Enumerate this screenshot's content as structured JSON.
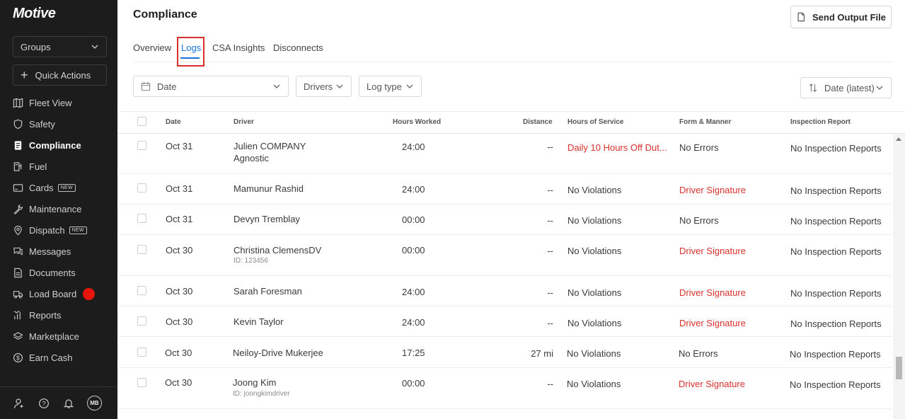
{
  "sidebar": {
    "logo": "Motive",
    "groups_label": "Groups",
    "quick_actions_label": "Quick Actions",
    "new_badge": "NEW",
    "items": [
      {
        "label": "Fleet View",
        "icon": "map-icon"
      },
      {
        "label": "Safety",
        "icon": "shield-icon"
      },
      {
        "label": "Compliance",
        "icon": "document-icon"
      },
      {
        "label": "Fuel",
        "icon": "fuel-pump-icon"
      },
      {
        "label": "Cards",
        "icon": "card-icon"
      },
      {
        "label": "Maintenance",
        "icon": "wrench-icon"
      },
      {
        "label": "Dispatch",
        "icon": "location-pin-icon"
      },
      {
        "label": "Messages",
        "icon": "chat-icon"
      },
      {
        "label": "Documents",
        "icon": "file-icon"
      },
      {
        "label": "Load Board",
        "icon": "truck-icon"
      },
      {
        "label": "Reports",
        "icon": "bar-chart-icon"
      },
      {
        "label": "Marketplace",
        "icon": "layers-icon"
      },
      {
        "label": "Earn Cash",
        "icon": "dollar-coin-icon"
      }
    ],
    "avatar_initials": "MB"
  },
  "header": {
    "title": "Compliance",
    "send_output_label": "Send Output File"
  },
  "tabs": [
    "Overview",
    "Logs",
    "CSA Insights",
    "Disconnects"
  ],
  "filters": {
    "date": "Date",
    "drivers": "Drivers",
    "log_type": "Log type",
    "sort": "Date (latest)"
  },
  "table": {
    "columns": [
      "Date",
      "Driver",
      "Hours Worked",
      "Distance",
      "Hours of Service",
      "Form & Manner",
      "Inspection Report"
    ],
    "rows": [
      {
        "date": "Oct 31",
        "driver": "Julien COMPANY",
        "driver2": "Agnostic",
        "hours": "24:00",
        "distance": "--",
        "hos": "Daily 10 Hours Off Dut...",
        "form": "No Errors",
        "inspection": "No Inspection Reports"
      },
      {
        "date": "Oct 31",
        "driver": "Mamunur Rashid",
        "hours": "24:00",
        "distance": "--",
        "hos": "No Violations",
        "form": "Driver Signature",
        "inspection": "No Inspection Reports"
      },
      {
        "date": "Oct 31",
        "driver": "Devyn Tremblay",
        "hours": "00:00",
        "distance": "--",
        "hos": "No Violations",
        "form": "No Errors",
        "inspection": "No Inspection Reports"
      },
      {
        "date": "Oct 30",
        "driver": "Christina ClemensDV",
        "driver_id": "ID: 123456",
        "hours": "00:00",
        "distance": "--",
        "hos": "No Violations",
        "form": "Driver Signature",
        "inspection": "No Inspection Reports"
      },
      {
        "date": "Oct 30",
        "driver": "Sarah Foresman",
        "hours": "24:00",
        "distance": "--",
        "hos": "No Violations",
        "form": "Driver Signature",
        "inspection": "No Inspection Reports"
      },
      {
        "date": "Oct 30",
        "driver": "Kevin Taylor",
        "hours": "24:00",
        "distance": "--",
        "hos": "No Violations",
        "form": "Driver Signature",
        "inspection": "No Inspection Reports"
      },
      {
        "date": "Oct 30",
        "driver": "Neiloy-Drive Mukerjee",
        "hours": "17:25",
        "distance": "27 mi",
        "hos": "No Violations",
        "form": "No Errors",
        "inspection": "No Inspection Reports"
      },
      {
        "date": "Oct 30",
        "driver": "Joong Kim",
        "driver_id": "ID: joongkimdriver",
        "hours": "00:00",
        "distance": "--",
        "hos": "No Violations",
        "form": "Driver Signature",
        "inspection": "No Inspection Reports"
      }
    ]
  },
  "colors": {
    "accent": "#1a73d9",
    "error": "#d9302c",
    "sidebar_bg": "#1c1c1c",
    "alert_dot": "#e8150d"
  }
}
